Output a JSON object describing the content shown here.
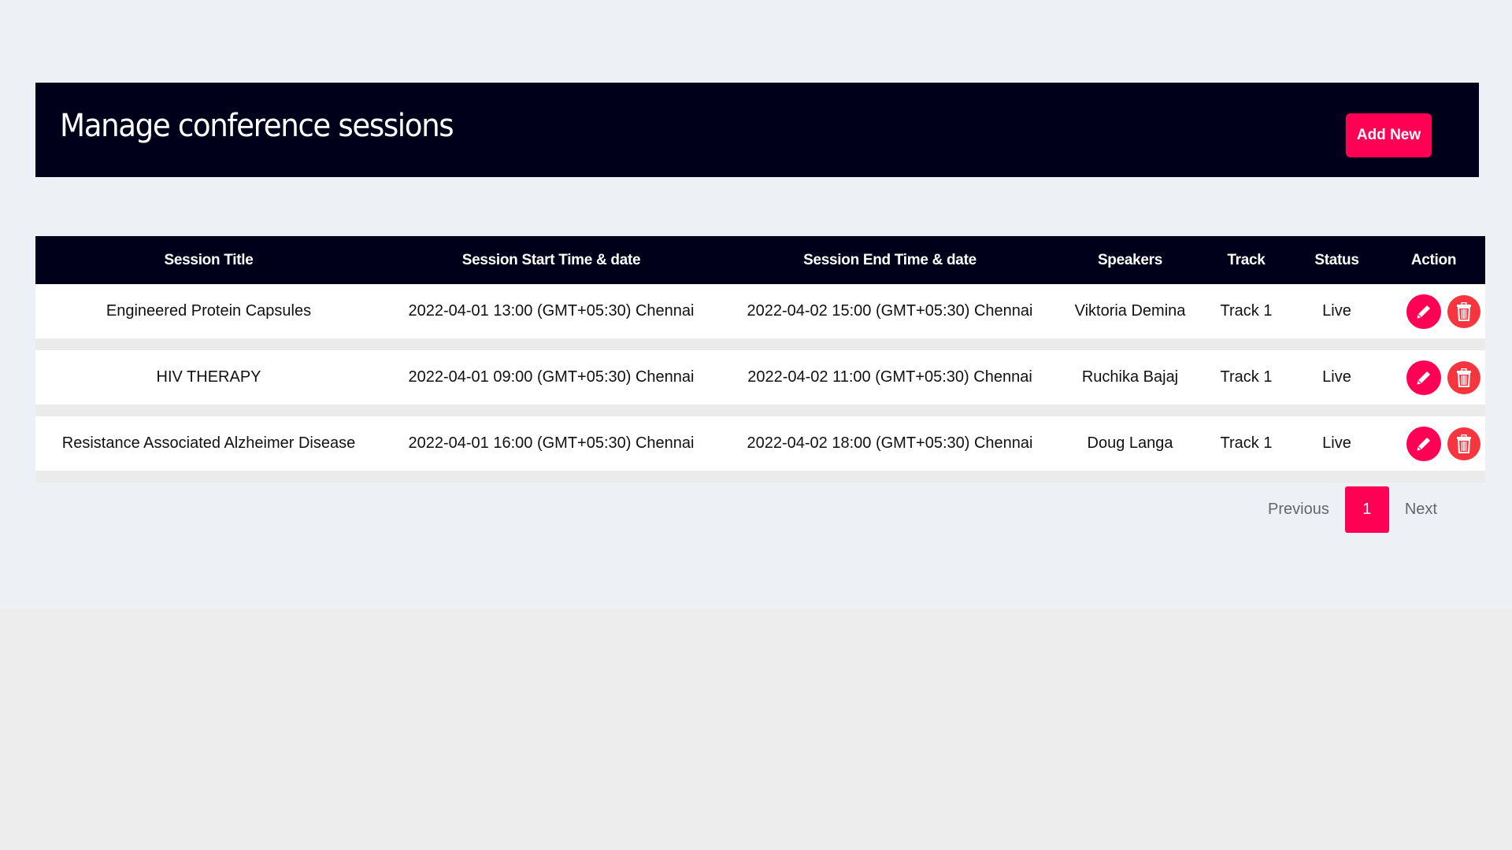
{
  "header": {
    "title": "Manage conference sessions",
    "add_button_label": "Add New"
  },
  "table": {
    "columns": [
      "Session Title",
      "Session Start Time & date",
      "Session End Time & date",
      "Speakers",
      "Track",
      "Status",
      "Action"
    ],
    "rows": [
      {
        "title": "Engineered Protein Capsules",
        "start": "2022-04-01 13:00 (GMT+05:30) Chennai",
        "end": "2022-04-02 15:00 (GMT+05:30) Chennai",
        "speakers": "Viktoria Demina",
        "track": "Track 1",
        "status": "Live"
      },
      {
        "title": "HIV THERAPY",
        "start": "2022-04-01 09:00 (GMT+05:30) Chennai",
        "end": "2022-04-02 11:00 (GMT+05:30) Chennai",
        "speakers": "Ruchika Bajaj",
        "track": "Track 1",
        "status": "Live"
      },
      {
        "title": "Resistance Associated Alzheimer Disease",
        "start": "2022-04-01 16:00 (GMT+05:30) Chennai",
        "end": "2022-04-02 18:00 (GMT+05:30) Chennai",
        "speakers": "Doug Langa",
        "track": "Track 1",
        "status": "Live"
      }
    ],
    "action_icons": [
      "pencil-icon",
      "trash-icon"
    ]
  },
  "pagination": {
    "previous_label": "Previous",
    "current_page": "1",
    "next_label": "Next"
  },
  "colors": {
    "header_bg": "#00001a",
    "accent": "#ff0055",
    "delete": "#f5363f",
    "page_bg": "#edf1f5"
  }
}
